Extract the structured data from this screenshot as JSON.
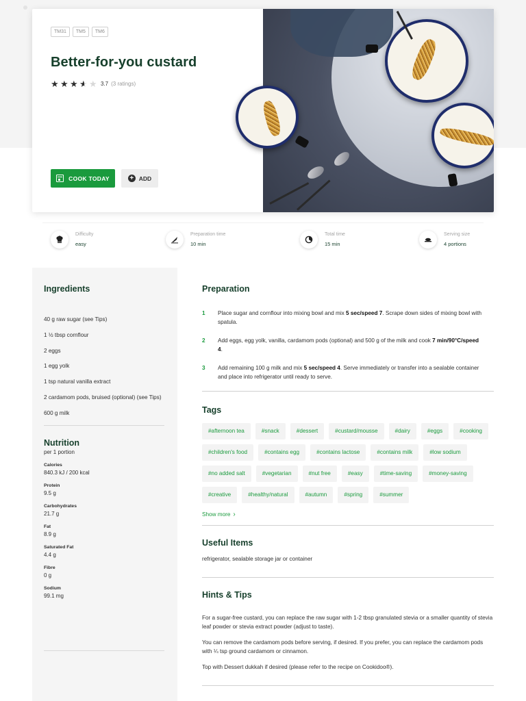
{
  "hero": {
    "chips": [
      "TM31",
      "TM5",
      "TM6"
    ],
    "title": "Better-for-you custard",
    "rating_value": "3.7",
    "rating_count": "(3 ratings)",
    "stars": 3.5,
    "cook_today_label": "COOK TODAY",
    "add_label": "ADD"
  },
  "info": {
    "difficulty": {
      "label": "Difficulty",
      "value": "easy",
      "icon": "chef-hat-icon"
    },
    "prep_time": {
      "label": "Preparation time",
      "value": "10 min",
      "icon": "knife-icon"
    },
    "total_time": {
      "label": "Total time",
      "value": "15 min",
      "icon": "timer-icon"
    },
    "serving": {
      "label": "Serving size",
      "value": "4 portions",
      "icon": "dish-icon"
    }
  },
  "ingredients": {
    "title": "Ingredients",
    "items": [
      "40 g raw sugar (see Tips)",
      "1 ½ tbsp cornflour",
      "2 eggs",
      "1 egg yolk",
      "1 tsp natural vanilla extract",
      "2 cardamom pods, bruised (optional) (see Tips)",
      "600 g milk"
    ]
  },
  "nutrition": {
    "title": "Nutrition",
    "subtitle": "per 1 portion",
    "items": [
      {
        "label": "Calories",
        "value": "840.3 kJ / 200 kcal"
      },
      {
        "label": "Protein",
        "value": "9.5 g"
      },
      {
        "label": "Carbohydrates",
        "value": "21.7 g"
      },
      {
        "label": "Fat",
        "value": "8.9 g"
      },
      {
        "label": "Saturated Fat",
        "value": "4.4 g"
      },
      {
        "label": "Fibre",
        "value": "0 g"
      },
      {
        "label": "Sodium",
        "value": "99.1 mg"
      }
    ]
  },
  "preparation": {
    "title": "Preparation",
    "steps": [
      {
        "num": "1",
        "pre": "Place sugar and cornflour into mixing bowl and mix ",
        "bold": "5 sec/speed 7",
        "post": ". Scrape down sides of mixing bowl with spatula."
      },
      {
        "num": "2",
        "pre": "Add eggs, egg yolk, vanilla, cardamom pods (optional) and 500 g of the milk and cook ",
        "bold": "7 min/90°C/speed 4",
        "post": "."
      },
      {
        "num": "3",
        "pre": "Add remaining 100 g milk and mix ",
        "bold": "5 sec/speed 4",
        "post": ". Serve immediately or transfer into a sealable container and place into refrigerator until ready to serve."
      }
    ]
  },
  "tags": {
    "title": "Tags",
    "items": [
      "#afternoon tea",
      "#snack",
      "#dessert",
      "#custard/mousse",
      "#dairy",
      "#eggs",
      "#cooking",
      "#children's food",
      "#contains egg",
      "#contains lactose",
      "#contains milk",
      "#low sodium",
      "#no added salt",
      "#vegetarian",
      "#nut free",
      "#easy",
      "#time-saving",
      "#money-saving",
      "#creative",
      "#healthy/natural",
      "#autumn",
      "#spring",
      "#summer"
    ],
    "show_more": "Show more"
  },
  "useful_items": {
    "title": "Useful Items",
    "text": "refrigerator, sealable storage jar or container"
  },
  "hints": {
    "title": "Hints & Tips",
    "paragraphs": [
      "For a sugar-free custard, you can replace the raw sugar with 1-2 tbsp granulated stevia or a smaller quantity of stevia leaf powder or stevia extract powder (adjust to taste).",
      "You can remove the cardamom pods before serving, if desired. If you prefer, you can replace the cardamom pods with ¼ tsp ground cardamom or cinnamon.",
      "Top with Dessert dukkah if desired (please refer to the recipe on Cookidoo®)."
    ]
  },
  "colors": {
    "brand_green": "#1a9a3d",
    "title_green": "#163f2b"
  }
}
